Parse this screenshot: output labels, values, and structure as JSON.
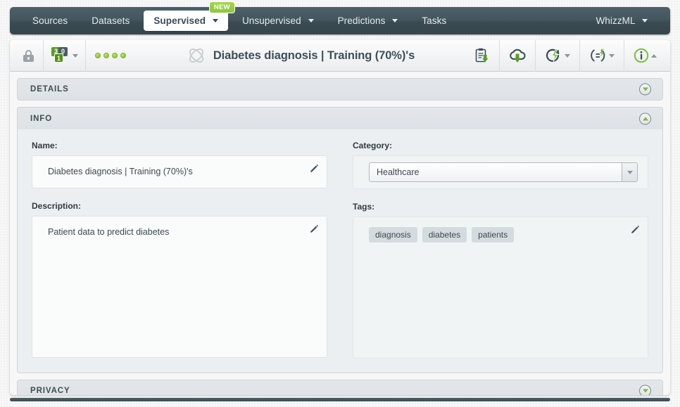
{
  "navbar": {
    "items": [
      {
        "label": "Sources",
        "has_caret": false,
        "active": false,
        "badge": null
      },
      {
        "label": "Datasets",
        "has_caret": false,
        "active": false,
        "badge": null
      },
      {
        "label": "Supervised",
        "has_caret": true,
        "active": true,
        "badge": "NEW"
      },
      {
        "label": "Unsupervised",
        "has_caret": true,
        "active": false,
        "badge": null
      },
      {
        "label": "Predictions",
        "has_caret": true,
        "active": false,
        "badge": null
      },
      {
        "label": "Tasks",
        "has_caret": false,
        "active": false,
        "badge": null
      }
    ],
    "right_item": {
      "label": "WhizzML",
      "has_caret": true
    }
  },
  "toolbar": {
    "lock_icon": "lock-icon",
    "fields_counts": {
      "numeric": "3",
      "categorical": "0",
      "objective": "1"
    },
    "status_dots": 4,
    "model_icon": "model-glyph-icon",
    "title": "Diabetes diagnosis | Training (70%)'s",
    "actions": [
      {
        "name": "download-clipboard-icon",
        "has_caret": false
      },
      {
        "name": "cloud-download-icon",
        "has_caret": false
      },
      {
        "name": "batch-prediction-icon",
        "has_caret": true
      },
      {
        "name": "evaluation-icon",
        "has_caret": true
      },
      {
        "name": "info-icon",
        "has_caret": true
      }
    ]
  },
  "sections": {
    "details": {
      "title": "DETAILS",
      "expanded": false
    },
    "info": {
      "title": "INFO",
      "expanded": true
    },
    "privacy": {
      "title": "PRIVACY",
      "expanded": false
    }
  },
  "info": {
    "name_label": "Name:",
    "name_value": "Diabetes diagnosis | Training (70%)'s",
    "category_label": "Category:",
    "category_value": "Healthcare",
    "description_label": "Description:",
    "description_value": "Patient data to predict diabetes",
    "tags_label": "Tags:",
    "tags": [
      "diagnosis",
      "diabetes",
      "patients"
    ]
  },
  "colors": {
    "navbar_dark": "#3b4b53",
    "accent_green": "#8cc63f",
    "panel_bg": "#f7f7f7",
    "section_header": "#e0e5e8"
  }
}
